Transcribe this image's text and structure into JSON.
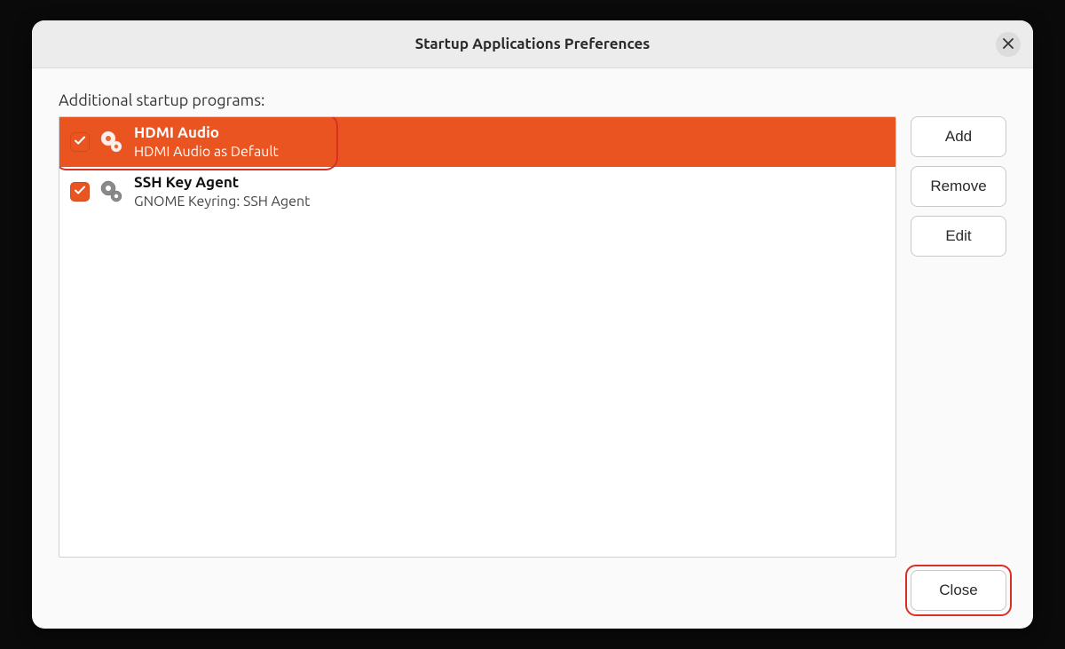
{
  "window": {
    "title": "Startup Applications Preferences"
  },
  "section_label": "Additional startup programs:",
  "list": {
    "items": [
      {
        "title": "HDMI Audio",
        "subtitle": "HDMI Audio as Default",
        "checked": true,
        "selected": true
      },
      {
        "title": "SSH Key Agent",
        "subtitle": "GNOME Keyring: SSH Agent",
        "checked": true,
        "selected": false
      }
    ]
  },
  "buttons": {
    "add": "Add",
    "remove": "Remove",
    "edit": "Edit",
    "close": "Close"
  },
  "colors": {
    "accent": "#e95420",
    "annotation": "#d93025"
  }
}
